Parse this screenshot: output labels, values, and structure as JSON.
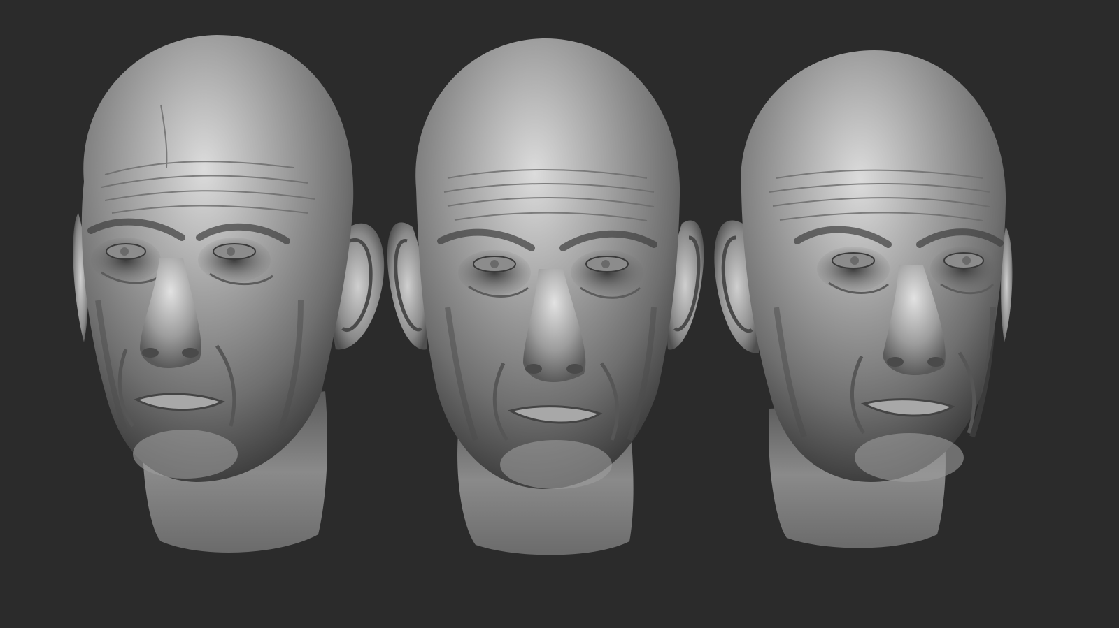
{
  "scene": {
    "background_color": "#2b2b2b",
    "material_color": "#9a9a9a",
    "render_style": "clay-sculpt"
  },
  "heads": [
    {
      "name": "head-left",
      "view": "three-quarter-left"
    },
    {
      "name": "head-center",
      "view": "front"
    },
    {
      "name": "head-right",
      "view": "three-quarter-right"
    }
  ]
}
